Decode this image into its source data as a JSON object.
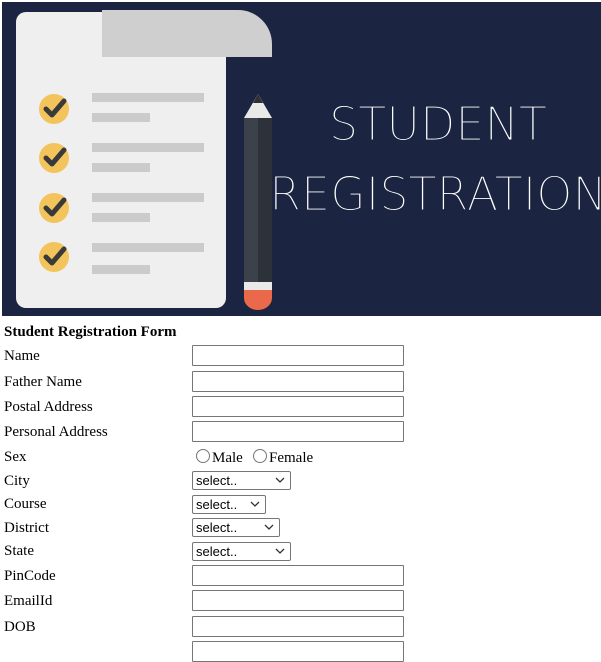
{
  "banner": {
    "title_line1": "STUDENT",
    "title_line2": "REGISTRATION",
    "bg_color": "#1b2541",
    "check_color": "#f3c45c"
  },
  "form": {
    "title": "Student Registration Form",
    "fields": {
      "name": "Name",
      "father_name": "Father Name",
      "postal_address": "Postal Address",
      "personal_address": "Personal Address",
      "sex": "Sex",
      "city": "City",
      "course": "Course",
      "district": "District",
      "state": "State",
      "pincode": "PinCode",
      "emailid": "EmailId",
      "dob": "DOB"
    },
    "sex_options": {
      "male": "Male",
      "female": "Female"
    },
    "select_placeholder": "select.."
  }
}
